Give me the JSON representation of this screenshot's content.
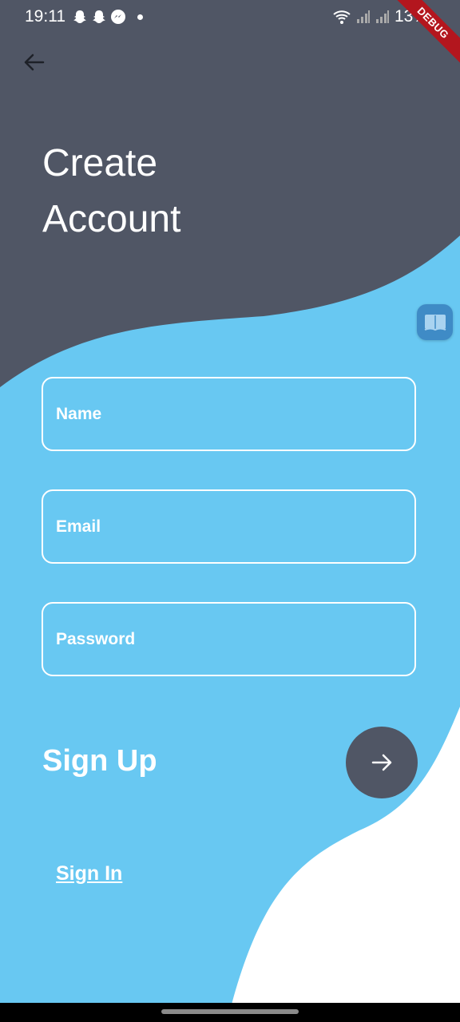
{
  "status_bar": {
    "time": "19:11",
    "battery": "13%",
    "debug_label": "DEBUG"
  },
  "header": {
    "title_line1": "Create",
    "title_line2": "Account"
  },
  "form": {
    "name_placeholder": "Name",
    "email_placeholder": "Email",
    "password_placeholder": "Password"
  },
  "actions": {
    "signup_label": "Sign Up",
    "signin_label": "Sign In"
  },
  "colors": {
    "dark": "#505665",
    "blue": "#68c8f2",
    "white": "#ffffff"
  },
  "icons": [
    "back-arrow-icon",
    "arrow-right-icon",
    "book-icon",
    "wifi-icon",
    "signal-icon",
    "battery-icon"
  ]
}
